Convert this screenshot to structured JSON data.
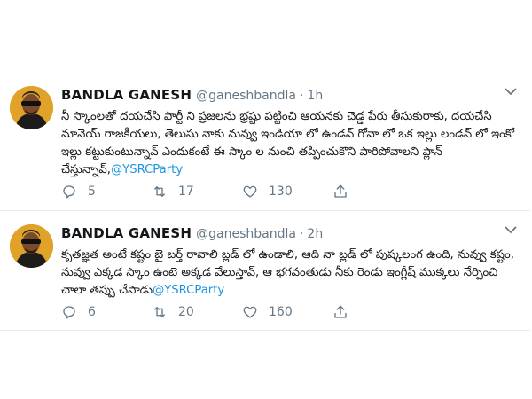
{
  "tweets": [
    {
      "name": "BANDLA GANESH",
      "handle": "@ganeshbandla",
      "separator": "·",
      "time": "1h",
      "text": "నీ స్కాంలతో దయచేసి పార్టీ ని ప్రజలను భ్రష్టు పట్టించి ఆయనకు చెడ్డ పేరు తీసుకురాకు, దయచేసి మానెయ్ రాజకీయలు, తెలుసు నాకు నువ్వు ఇండియా లో ఉండవ్ గోవా లో ఒక ఇల్లు లండన్ లో ఇంకో ఇల్లు కట్టుకుంటున్నావ్ ఎందుకంటే ఈ స్కాం ల నుంచి తప్పించుకొని పారిపోవాలని ప్లాన్ చేస్తున్నావ్,",
      "mention": "@YSRCParty",
      "replies": "5",
      "retweets": "17",
      "likes": "130"
    },
    {
      "name": "BANDLA GANESH",
      "handle": "@ganeshbandla",
      "separator": "·",
      "time": "2h",
      "text": "కృతజ్ఞత అంటే కష్టం బై బర్త్ రావాలి బ్లడ్ లో ఉండాలి, ఆది నా బ్లడ్ లో పుష్కలంగ ఉంది, నువ్వు కష్టం, నువ్వు ఎక్కడ స్కాం ఉంటె అక్కడ వేలుస్తావ్, ఆ భగవంతుడు నీకు రెండు ఇంగ్లీష్ ముక్కలు నేర్పించి చాలా తప్పు చేసాడు",
      "mention": "@YSRCParty",
      "replies": "6",
      "retweets": "20",
      "likes": "160"
    }
  ],
  "icons": {
    "reply": "reply-icon",
    "retweet": "retweet-icon",
    "like": "heart-icon",
    "share": "share-icon",
    "menu": "chevron-down-icon"
  },
  "colors": {
    "text": "#14171a",
    "muted": "#657786",
    "link": "#1b95e0",
    "divider": "#e6ecf0",
    "avatar_bg": "#e0a228"
  }
}
